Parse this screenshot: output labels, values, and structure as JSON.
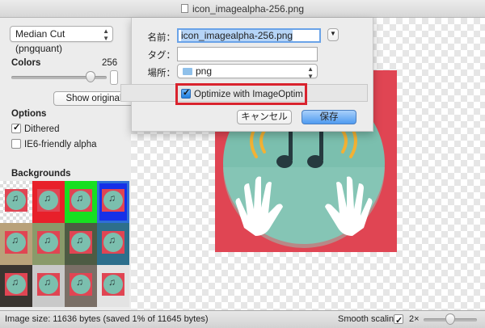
{
  "window": {
    "title": "icon_imagealpha-256.png"
  },
  "sidebar": {
    "quantizer": "Median Cut (pngquant)",
    "colors_label": "Colors",
    "colors_value": "256",
    "show_original": "Show original",
    "options_label": "Options",
    "dithered": {
      "label": "Dithered",
      "checked": true
    },
    "ie6": {
      "label": "IE6-friendly alpha",
      "checked": false
    },
    "backgrounds_label": "Backgrounds"
  },
  "save_sheet": {
    "name_label": "名前：",
    "name_value": "icon_imagealpha-256.png",
    "tags_label": "タグ：",
    "tags_value": "",
    "location_label": "場所：",
    "location_value": "png",
    "optimize": {
      "label": "Optimize with ImageOptim",
      "checked": true
    },
    "cancel": "キャンセル",
    "save": "保存"
  },
  "status": {
    "text": "Image size: 11636 bytes (saved 1% of 11645 bytes)",
    "smooth_label": "Smooth scaling",
    "smooth_checked": true,
    "zoom": "2×"
  },
  "colors": {
    "highlight_box": "#d9232e",
    "icon_red": "#e04553",
    "icon_teal": "#7bbfae",
    "accent_blue": "#2f6fd6"
  }
}
